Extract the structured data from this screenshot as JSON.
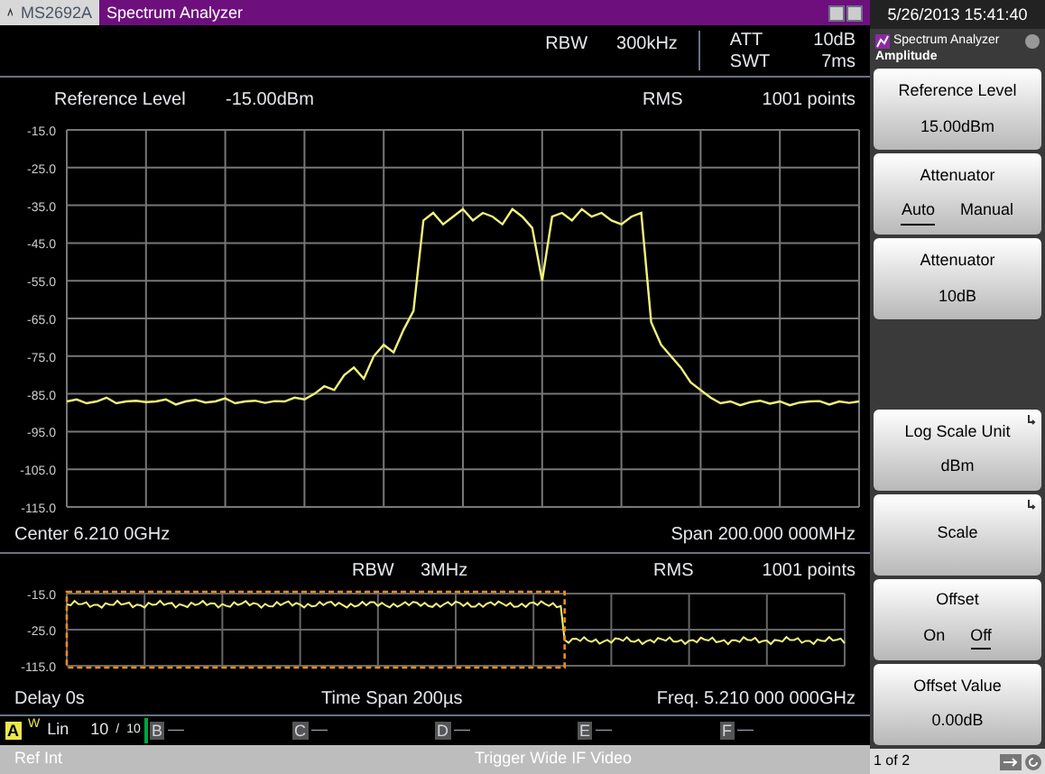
{
  "title_bar": {
    "model": "MS2692A",
    "title": "Spectrum Analyzer"
  },
  "header": {
    "left": [
      {
        "label": "RBW",
        "value": "300kHz"
      }
    ],
    "right": [
      {
        "label": "ATT",
        "value": "10dB"
      },
      {
        "label": "SWT",
        "value": "7ms"
      }
    ]
  },
  "main_trace": {
    "ref_label": "Reference Level",
    "ref_value": "-15.00dBm",
    "detector": "RMS",
    "points": "1001 points",
    "center": "Center 6.210 0GHz",
    "span": "Span 200.000 000MHz",
    "chart_data": {
      "type": "line",
      "grid": true,
      "ylim": [
        -115,
        -15
      ],
      "yticks": [
        {
          "value": -15,
          "label": "-15.0"
        },
        {
          "value": -25,
          "label": "-25.0"
        },
        {
          "value": -35,
          "label": "-35.0"
        },
        {
          "value": -45,
          "label": "-45.0"
        },
        {
          "value": -55,
          "label": "-55.0"
        },
        {
          "value": -65,
          "label": "-65.0"
        },
        {
          "value": -75,
          "label": "-75.0"
        },
        {
          "value": -85,
          "label": "-85.0"
        },
        {
          "value": -95,
          "label": "-95.0"
        },
        {
          "value": -105,
          "label": "-105.0"
        },
        {
          "value": -115,
          "label": "-115.0"
        }
      ],
      "series": [
        {
          "color": "#f2f27a",
          "values": [
            -87,
            -86.5,
            -87.5,
            -87,
            -86,
            -87.5,
            -87,
            -86.8,
            -87.2,
            -87,
            -86.5,
            -87.8,
            -87,
            -86.6,
            -87.3,
            -87,
            -86.2,
            -87.5,
            -87,
            -86.8,
            -87.4,
            -86.9,
            -87,
            -86,
            -86.5,
            -85,
            -83,
            -84,
            -80,
            -78,
            -81,
            -75,
            -72,
            -74,
            -68,
            -63,
            -39,
            -37,
            -40,
            -38,
            -36,
            -39,
            -37,
            -38,
            -40,
            -36,
            -38,
            -41,
            -55,
            -38,
            -37,
            -39,
            -36,
            -38,
            -37,
            -39,
            -40,
            -38,
            -37,
            -66,
            -72,
            -75,
            -78,
            -82,
            -84,
            -86,
            -87.5,
            -87,
            -88,
            -87.2,
            -86.8,
            -87.6,
            -87,
            -88,
            -87.3,
            -87,
            -86.9,
            -87.8,
            -87,
            -87.4,
            -87
          ]
        }
      ]
    }
  },
  "time_trace": {
    "rbw_label": "RBW",
    "rbw_value": "3MHz",
    "detector": "RMS",
    "points": "1001 points",
    "y_labels": [
      "-15.0",
      "-25.0",
      "-115.0"
    ],
    "delay": "Delay 0s",
    "time_span": "Time Span 200µs",
    "freq": "Freq. 5.210 000 000GHz"
  },
  "trace_status": {
    "active": {
      "letter": "A",
      "mode_letter": "W",
      "mode": "Lin",
      "count": "10",
      "slash": "/",
      "total": "10"
    },
    "others": [
      {
        "letter": "B",
        "value": "—"
      },
      {
        "letter": "C",
        "value": "—"
      },
      {
        "letter": "D",
        "value": "—"
      },
      {
        "letter": "E",
        "value": "—"
      },
      {
        "letter": "F",
        "value": "—"
      }
    ]
  },
  "status_bar": {
    "left": "Ref Int",
    "center": "Trigger Wide IF Video"
  },
  "softkeys": {
    "clock": "5/26/2013 15:41:40",
    "app": "Spectrum Analyzer",
    "menu_title": "Amplitude",
    "page": "1 of 2",
    "keys": [
      {
        "kind": "value",
        "label": "Reference Level",
        "value": "15.00dBm",
        "has_submenu": false
      },
      {
        "kind": "toggle",
        "label": "Attenuator",
        "options": [
          {
            "label": "Auto",
            "selected": true
          },
          {
            "label": "Manual",
            "selected": false
          }
        ],
        "has_submenu": false
      },
      {
        "kind": "value",
        "label": "Attenuator",
        "value": "10dB",
        "has_submenu": false
      },
      {
        "kind": "blank"
      },
      {
        "kind": "value",
        "label": "Log Scale Unit",
        "value": "dBm",
        "has_submenu": true
      },
      {
        "kind": "value",
        "label": "Scale",
        "has_submenu": true
      },
      {
        "kind": "toggle",
        "label": "Offset",
        "options": [
          {
            "label": "On",
            "selected": false
          },
          {
            "label": "Off",
            "selected": true
          }
        ],
        "has_submenu": false
      },
      {
        "kind": "value",
        "label": "Offset Value",
        "value": "0.00dB",
        "has_submenu": false
      }
    ]
  }
}
